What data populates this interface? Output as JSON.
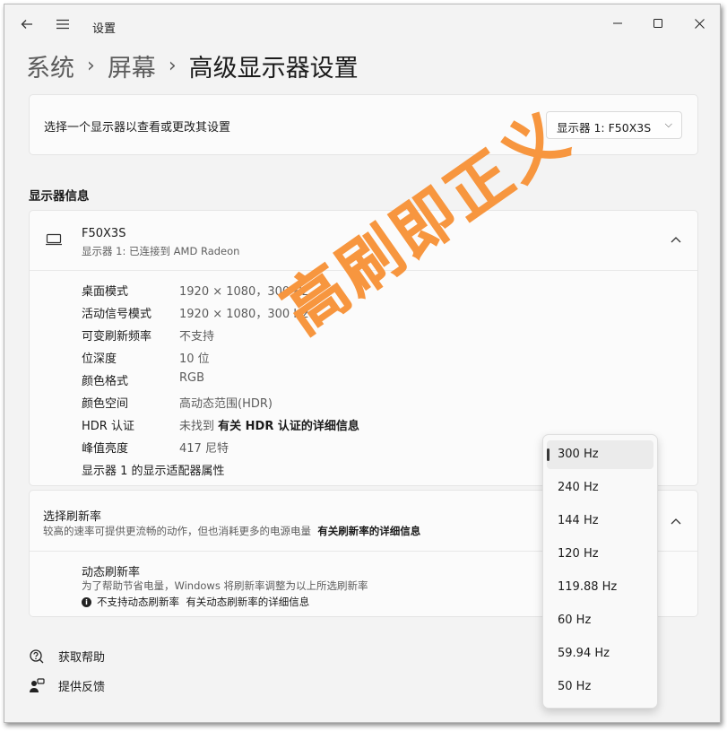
{
  "window": {
    "title": "设置",
    "icons": [
      "back-arrow-icon",
      "hamburger-menu-icon",
      "minimize-icon",
      "maximize-icon",
      "close-icon"
    ]
  },
  "breadcrumb": [
    "系统",
    "屏幕",
    "高级显示器设置"
  ],
  "display_select": {
    "label": "选择一个显示器以查看或更改其设置",
    "value": "显示器 1: F50X3S"
  },
  "display_info": {
    "section_title": "显示器信息",
    "name": "F50X3S",
    "subtitle": "显示器 1: 已连接到 AMD Radeon",
    "rows": [
      {
        "key": "桌面模式",
        "value": "1920 × 1080，300 Hz"
      },
      {
        "key": "活动信号模式",
        "value": "1920 × 1080，300 Hz"
      },
      {
        "key": "可变刷新频率",
        "value": "不支持"
      },
      {
        "key": "位深度",
        "value": "10 位"
      },
      {
        "key": "颜色格式",
        "value": "RGB"
      },
      {
        "key": "颜色空间",
        "value": "高动态范围(HDR)"
      },
      {
        "key": "HDR 认证",
        "value": "未找到",
        "link": "有关 HDR 认证的详细信息"
      },
      {
        "key": "峰值亮度",
        "value": "417 尼特"
      }
    ],
    "adapter_link": "显示器 1 的显示适配器属性"
  },
  "refresh": {
    "title": "选择刷新率",
    "desc": "较高的速率可提供更流畅的动作，但也消耗更多的电源电量",
    "desc_link": "有关刷新率的详细信息",
    "dynamic_title": "动态刷新率",
    "dynamic_desc": "为了帮助节省电量，Windows 将刷新率调整为以上所选刷新率",
    "dynamic_note": "不支持动态刷新率",
    "dynamic_link": "有关动态刷新率的详细信息"
  },
  "dropdown_options": [
    "300 Hz",
    "240 Hz",
    "144 Hz",
    "120 Hz",
    "119.88 Hz",
    "60 Hz",
    "59.94 Hz",
    "50 Hz"
  ],
  "dropdown_selected": "300 Hz",
  "footer": {
    "help": "获取帮助",
    "feedback": "提供反馈"
  },
  "watermark": "高刷即正义",
  "colors": {
    "watermark": "#f7963f",
    "background": "#f3f3f3",
    "card": "#fbfbfb"
  }
}
